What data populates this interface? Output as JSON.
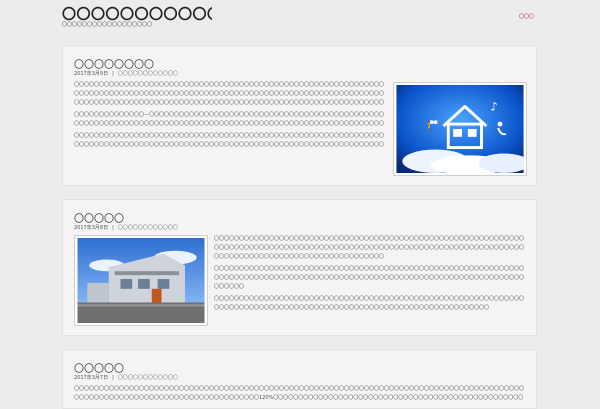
{
  "site": {
    "title": "〇〇〇〇〇〇〇〇〇〇〇〇〇〇〇〇〇〇",
    "description": "〇〇〇〇〇〇〇〇〇〇〇〇〇〇〇〇〇〇",
    "menu_label": "〇〇〇"
  },
  "posts": [
    {
      "title": "〇〇〇〇〇〇〇〇",
      "date": "2017年3月9日",
      "category": "〇〇〇〇〇〇〇〇〇〇〇〇",
      "image_icon": "house-in-sky-icon",
      "paragraphs": [
        "〇〇〇〇〇〇〇〇〇〇〇〇〇〇〇〇〇〇〇〇〇〇〇〇〇〇〇〇〇〇〇〇〇〇〇〇〇〇〇〇〇〇〇〇〇〇〇〇〇〇〇〇〇〇〇〇〇〇〇〇〇〇〇〇〇〇〇〇〇〇〇〇〇〇〇〇〇〇〇〇〇〇〇〇〇〇〇〇〇〇〇〇〇〇〇〇〇〇〇〇〇〇〇〇〇〇〇〇〇〇〇〇〇〇〇〇〇〇〇〇〇〇〇〇〇〇〇〇〇〇〇〇〇〇〇〇〇〇〇〇〇〇〇〇〇〇〇〇〇〇〇〇〇〇〇〇〇〇〇〇〇〇〇〇〇〇〇〇〇〇〇〇〇〇〇〇〇〇〇〇〇〇〇〇〇〇〇〇〇〇〇〇〇〇〇〇〇〇〇〇〇〇",
        "〇〇〇〇〇〇〇〇〇〇〇〇〇〇—〇〇〇〇〇〇〇〇〇〇〇〇〇〇〇〇〇〇〇〇〇〇〇〇〇〇〇〇〇〇〇〇〇〇〇〇〇〇〇〇〇〇〇〇〇〇〇〇〇〇〇〇〇〇〇〇〇〇〇〇〇〇〇〇〇〇〇〇〇〇〇〇〇〇〇〇〇〇〇〇〇〇〇〇〇〇〇〇〇〇〇〇〇〇〇〇〇〇〇〇〇〇〇〇〇〇〇〇〇〇〇〇〇〇〇〇〇〇〇〇〇〇〇〇〇〇",
        "〇〇〇〇〇〇〇〇〇〇〇〇〇〇〇〇〇〇〇〇〇〇〇〇〇〇〇〇〇〇〇〇〇〇〇〇〇〇〇〇〇〇〇〇〇〇〇〇〇〇〇〇〇〇〇〇〇〇〇〇〇〇〇〇〇〇〇〇〇〇〇〇〇〇〇〇〇〇〇〇〇〇〇〇〇〇〇〇〇〇〇〇〇〇〇〇〇〇〇〇〇〇〇〇〇〇〇〇〇〇〇〇〇〇〇〇〇〇〇〇〇〇〇〇〇〇〇〇〇〇〇〇〇〇〇〇〇〇〇〇〇〇〇〇〇〇〇〇"
      ]
    },
    {
      "title": "〇〇〇〇〇",
      "date": "2017年3月8日",
      "category": "〇〇〇〇〇〇〇〇〇〇〇〇",
      "image_icon": "modern-house-icon",
      "paragraphs": [
        "〇〇〇〇〇〇〇〇〇〇〇〇〇〇〇〇〇〇〇〇〇〇〇〇〇〇〇〇〇〇〇〇〇〇〇〇〇〇〇〇〇〇〇〇〇〇〇〇〇〇〇〇〇〇〇〇〇〇〇〇〇〇〇〇〇〇〇〇〇〇〇〇〇〇〇〇〇〇〇〇〇〇〇〇〇〇〇〇〇〇〇〇〇〇〇〇〇〇〇〇〇〇〇〇〇〇〇〇〇〇〇〇〇〇〇〇〇〇〇〇〇〇〇〇〇〇〇〇〇〇〇〇〇〇〇〇〇〇〇〇〇〇〇〇〇〇〇〇〇〇〇〇〇〇〇〇〇〇",
        "〇〇〇〇〇〇〇〇〇〇〇〇〇〇〇〇〇〇〇〇〇〇〇〇〇〇〇〇〇〇〇〇〇〇〇〇〇〇〇〇〇〇〇〇〇〇〇〇〇〇〇〇〇〇〇〇〇〇〇〇〇〇〇〇〇〇〇〇〇〇〇〇〇〇〇〇〇〇〇〇〇〇〇〇〇〇〇〇〇〇〇〇〇〇〇〇〇〇〇〇〇〇〇〇〇〇〇〇〇〇〇〇〇〇〇〇〇〇〇〇〇〇〇〇〇〇〇〇〇〇",
        "〇〇〇〇〇〇〇〇〇〇〇〇〇〇〇〇〇〇〇〇〇〇〇〇〇〇〇〇〇〇〇〇〇〇〇〇〇〇〇〇〇〇〇〇〇〇〇〇〇〇〇〇〇〇〇〇〇〇〇〇〇〇〇〇〇〇〇〇〇〇〇〇〇〇〇〇〇〇〇〇〇〇〇〇〇〇〇〇〇〇〇〇〇〇〇〇〇〇〇〇〇〇〇〇〇〇〇〇〇〇〇〇〇〇〇〇〇"
      ]
    },
    {
      "title": "〇〇〇〇〇",
      "date": "2017年3月7日",
      "category": "〇〇〇〇〇〇〇〇〇〇〇〇",
      "paragraphs": [
        "〇〇〇〇〇〇〇〇〇〇〇〇〇〇〇〇〇〇〇〇〇〇〇〇〇〇〇〇〇〇〇〇〇〇〇〇〇〇〇〇〇〇〇〇〇〇〇〇〇〇〇〇〇〇〇〇〇〇〇〇〇〇〇〇〇〇〇〇〇〇〇〇〇〇〇〇〇〇〇〇〇〇〇〇〇〇〇〇〇〇〇〇〇〇〇〇〇〇〇〇〇〇〇〇〇〇〇〇〇〇〇〇〇〇〇〇〇〇〇〇〇〇〇〇〇〇〇120%〇〇〇〇〇〇〇〇〇〇〇〇〇〇〇〇〇〇〇〇〇〇〇〇〇〇〇〇〇〇〇〇〇〇〇〇〇〇〇〇〇〇〇〇〇〇〇〇〇〇〇〇〇〇〇〇〇〇〇〇〇〇〇〇〇〇〇〇〇〇〇〇〇〇〇〇〇〇〇〇"
      ]
    }
  ],
  "colors": {
    "menu": "#9b1d1d",
    "link": "#2f6fc0",
    "card_bg": "#f5f3f3",
    "page_bg": "#ececec"
  }
}
